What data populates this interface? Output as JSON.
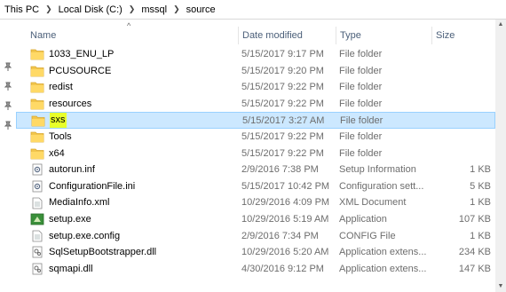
{
  "breadcrumb": [
    "This PC",
    "Local Disk (C:)",
    "mssql",
    "source"
  ],
  "columns": {
    "name": "Name",
    "date": "Date modified",
    "type": "Type",
    "size": "Size"
  },
  "sort_arrow": "^",
  "rows": [
    {
      "name": "1033_ENU_LP",
      "date": "5/15/2017 9:17 PM",
      "type": "File folder",
      "size": "",
      "icon": "folder-icon"
    },
    {
      "name": "PCUSOURCE",
      "date": "5/15/2017 9:20 PM",
      "type": "File folder",
      "size": "",
      "icon": "folder-icon"
    },
    {
      "name": "redist",
      "date": "5/15/2017 9:22 PM",
      "type": "File folder",
      "size": "",
      "icon": "folder-icon"
    },
    {
      "name": "resources",
      "date": "5/15/2017 9:22 PM",
      "type": "File folder",
      "size": "",
      "icon": "folder-icon"
    },
    {
      "name": "sxs",
      "date": "5/15/2017 3:27 AM",
      "type": "File folder",
      "size": "",
      "icon": "folder-icon",
      "selected": true
    },
    {
      "name": "Tools",
      "date": "5/15/2017 9:22 PM",
      "type": "File folder",
      "size": "",
      "icon": "folder-icon"
    },
    {
      "name": "x64",
      "date": "5/15/2017 9:22 PM",
      "type": "File folder",
      "size": "",
      "icon": "folder-icon"
    },
    {
      "name": "autorun.inf",
      "date": "2/9/2016 7:38 PM",
      "type": "Setup Information",
      "size": "1 KB",
      "icon": "settings-file-icon"
    },
    {
      "name": "ConfigurationFile.ini",
      "date": "5/15/2017 10:42 PM",
      "type": "Configuration sett...",
      "size": "5 KB",
      "icon": "settings-file-icon"
    },
    {
      "name": "MediaInfo.xml",
      "date": "10/29/2016 4:09 PM",
      "type": "XML Document",
      "size": "1 KB",
      "icon": "document-file-icon"
    },
    {
      "name": "setup.exe",
      "date": "10/29/2016 5:19 AM",
      "type": "Application",
      "size": "107 KB",
      "icon": "setup-app-icon"
    },
    {
      "name": "setup.exe.config",
      "date": "2/9/2016 7:34 PM",
      "type": "CONFIG File",
      "size": "1 KB",
      "icon": "document-file-icon"
    },
    {
      "name": "SqlSetupBootstrapper.dll",
      "date": "10/29/2016 5:20 AM",
      "type": "Application extens...",
      "size": "234 KB",
      "icon": "dll-file-icon"
    },
    {
      "name": "sqmapi.dll",
      "date": "4/30/2016 9:12 PM",
      "type": "Application extens...",
      "size": "147 KB",
      "icon": "dll-file-icon"
    }
  ],
  "colors": {
    "selection": "#cce8ff",
    "selection_border": "#99d1ff",
    "header_text": "#4c607a",
    "folder": "#f2c64d",
    "name_highlight": "#e8ff2a"
  }
}
